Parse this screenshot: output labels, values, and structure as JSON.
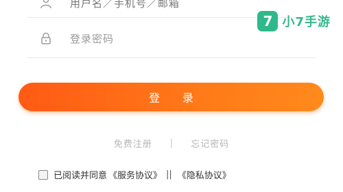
{
  "login_form": {
    "username_placeholder": "用户名／手机号／邮箱",
    "password_placeholder": "登录密码",
    "login_button": "登 录"
  },
  "links": {
    "register": "免费注册",
    "separator": "|",
    "forgot_password": "忘记密码"
  },
  "agreement": {
    "prefix": "已阅读并同意",
    "service_agreement": "《服务协议》",
    "conjunction": "||",
    "privacy_agreement": "《隐私协议》",
    "checked": false
  },
  "watermark": {
    "logo_char": "7",
    "text": "小7手游"
  },
  "colors": {
    "accent": "#ff6a16",
    "watermark": "#2fb98a",
    "placeholder": "#9a9a9a"
  },
  "icons": {
    "user": "user-icon",
    "lock": "lock-icon"
  }
}
